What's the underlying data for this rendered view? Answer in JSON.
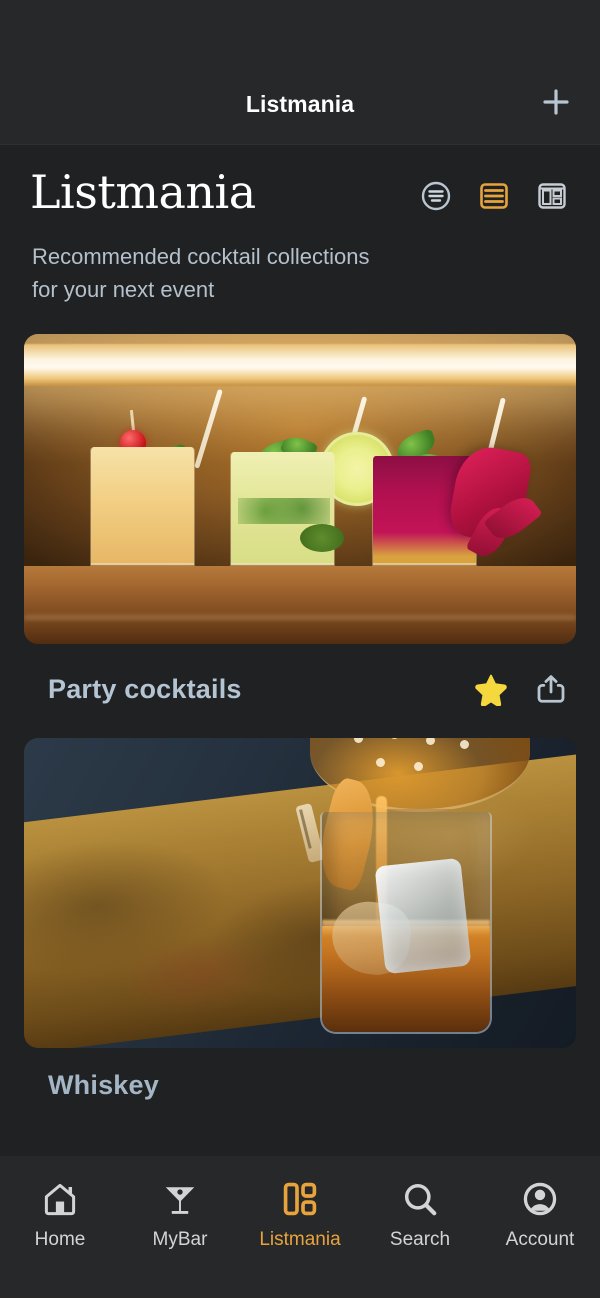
{
  "appbar": {
    "title": "Listmania",
    "add_label": "+",
    "add_icon": "plus-icon"
  },
  "header": {
    "title": "Listmania",
    "subtitle_line1": "Recommended cocktail collections",
    "subtitle_line2": "for your next event",
    "view_modes": [
      {
        "name": "sort-icon",
        "label": "Sort",
        "active": false,
        "color": "#b9c6d2"
      },
      {
        "name": "list-view-icon",
        "label": "List view",
        "active": true,
        "color": "#e8a33d"
      },
      {
        "name": "grid-view-icon",
        "label": "Grid view",
        "active": false,
        "color": "#c7cdd2"
      }
    ]
  },
  "collections": [
    {
      "title": "Party cocktails",
      "image_alt": "Three colorful cocktails on a wooden bar under warm light",
      "favorite": true,
      "favorite_icon": "star-icon",
      "share_icon": "share-icon"
    },
    {
      "title": "Whiskey",
      "image_alt": "Whiskey being poured over a large ice cube with orange peel garnish",
      "favorite": false,
      "favorite_icon": "star-icon",
      "share_icon": "share-icon"
    }
  ],
  "bottom_nav": {
    "items": [
      {
        "label": "Home",
        "icon": "home-icon",
        "active": false
      },
      {
        "label": "MyBar",
        "icon": "martini-glass-icon",
        "active": false
      },
      {
        "label": "Listmania",
        "icon": "listmania-grid-icon",
        "active": true
      },
      {
        "label": "Search",
        "icon": "search-icon",
        "active": false
      },
      {
        "label": "Account",
        "icon": "account-circle-icon",
        "active": false
      }
    ]
  },
  "colors": {
    "background": "#1f2123",
    "surface": "#26282a",
    "accent": "#e8a33d",
    "star": "#f5d73e",
    "text_primary": "#ffffff",
    "text_secondary": "#b4c0cb",
    "card_title": "#b4c4d2"
  }
}
